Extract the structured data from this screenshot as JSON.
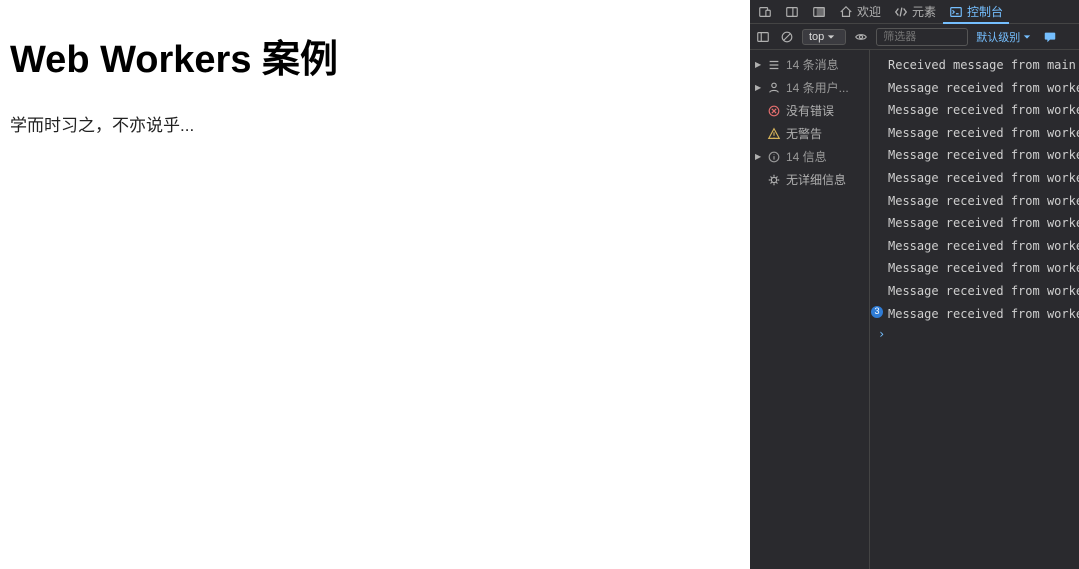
{
  "page": {
    "heading": "Web Workers 案例",
    "text": "学而时习之，不亦说乎..."
  },
  "devtools": {
    "tabs": {
      "welcome": "欢迎",
      "elements": "元素",
      "console": "控制台"
    },
    "toolbar": {
      "context": "top",
      "filter_placeholder": "筛选器",
      "level_label": "默认级别"
    },
    "sidebar": {
      "messages": "14 条消息",
      "users": "14 条用户...",
      "no_errors": "没有错误",
      "no_warnings": "无警告",
      "info": "14 信息",
      "no_verbose": "无详细信息"
    },
    "logs": [
      {
        "text": "Received message from main thread",
        "badge": null
      },
      {
        "text": "Message received from worker: 学",
        "badge": null
      },
      {
        "text": "Message received from worker: 而",
        "badge": null
      },
      {
        "text": "Message received from worker: 时",
        "badge": null
      },
      {
        "text": "Message received from worker: 习",
        "badge": null
      },
      {
        "text": "Message received from worker: 之",
        "badge": null
      },
      {
        "text": "Message received from worker: ，",
        "badge": null
      },
      {
        "text": "Message received from worker: 不",
        "badge": null
      },
      {
        "text": "Message received from worker: 亦",
        "badge": null
      },
      {
        "text": "Message received from worker: 说",
        "badge": null
      },
      {
        "text": "Message received from worker: 乎",
        "badge": null
      },
      {
        "text": "Message received from worker: .",
        "badge": "3"
      }
    ],
    "prompt": "›"
  }
}
